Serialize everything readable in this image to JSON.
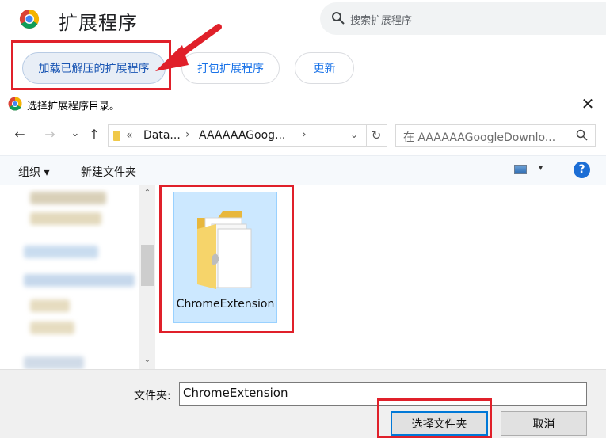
{
  "chrome": {
    "page_title": "扩展程序",
    "search_placeholder": "搜索扩展程序",
    "buttons": {
      "load_unpacked": "加载已解压的扩展程序",
      "pack": "打包扩展程序",
      "update": "更新"
    }
  },
  "dialog": {
    "title": "选择扩展程序目录。",
    "close_glyph": "✕",
    "nav": {
      "back": "←",
      "forward": "→",
      "history": "⌄",
      "up": "↑",
      "refresh": "↻"
    },
    "address": {
      "prefix": "«",
      "crumbs": [
        "Data...",
        "AAAAAAGoog..."
      ],
      "separator": "›",
      "dropdown": "⌄"
    },
    "search_placeholder": "在 AAAAAAGoogleDownlo...",
    "toolbar": {
      "organize": "组织 ▾",
      "new_folder": "新建文件夹",
      "view_caret": "▾",
      "help": "?"
    },
    "scroll": {
      "up": "⌃",
      "down": "⌄"
    },
    "items": [
      {
        "name": "ChromeExtension",
        "type": "folder",
        "selected": true
      }
    ],
    "footer": {
      "folder_label": "文件夹:",
      "folder_value": "ChromeExtension",
      "select_button": "选择文件夹",
      "cancel_button": "取消"
    }
  },
  "annotations": {
    "highlight_color": "#e0202a"
  },
  "colors": {
    "accent": "#1a73e8",
    "selection": "#cce8ff",
    "folder": "#f0c94a"
  }
}
